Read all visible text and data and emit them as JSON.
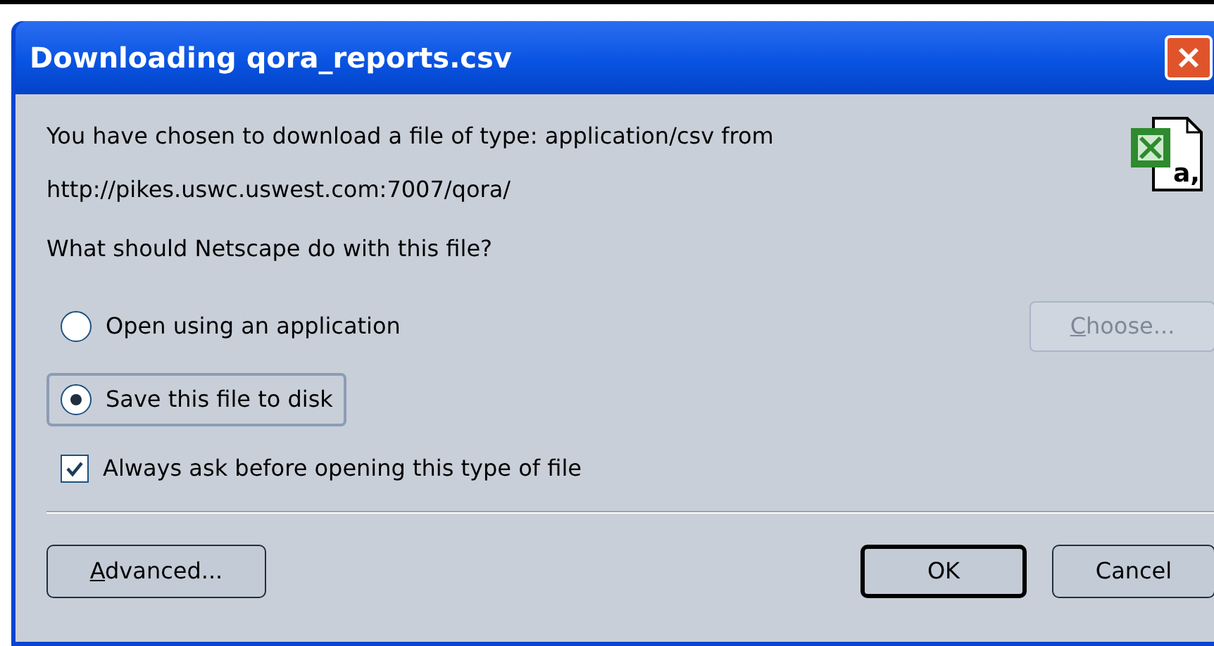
{
  "window": {
    "title": "Downloading qora_reports.csv"
  },
  "message": [
    "You have chosen to download a file of type: application/csv from",
    "http://pikes.uswc.uswest.com:7007/qora/"
  ],
  "file_icon_text": "a,",
  "question": "What should Netscape do with this file?",
  "options": [
    {
      "label": "Open using an application",
      "selected": false
    },
    {
      "label": "Save this file to disk",
      "selected": true
    }
  ],
  "choose_button": {
    "label": "Choose...",
    "disabled": true,
    "mnemonic_underlined": true
  },
  "always_ask": {
    "label": "Always ask before opening this type of file",
    "checked": true
  },
  "buttons": [
    {
      "label": "Advanced...",
      "kind": "left",
      "mnemonic_underlined": true,
      "default": false
    },
    {
      "label": "OK",
      "kind": "right",
      "mnemonic_underlined": false,
      "default": true
    },
    {
      "label": "Cancel",
      "kind": "right",
      "mnemonic_underlined": false,
      "default": false
    }
  ]
}
